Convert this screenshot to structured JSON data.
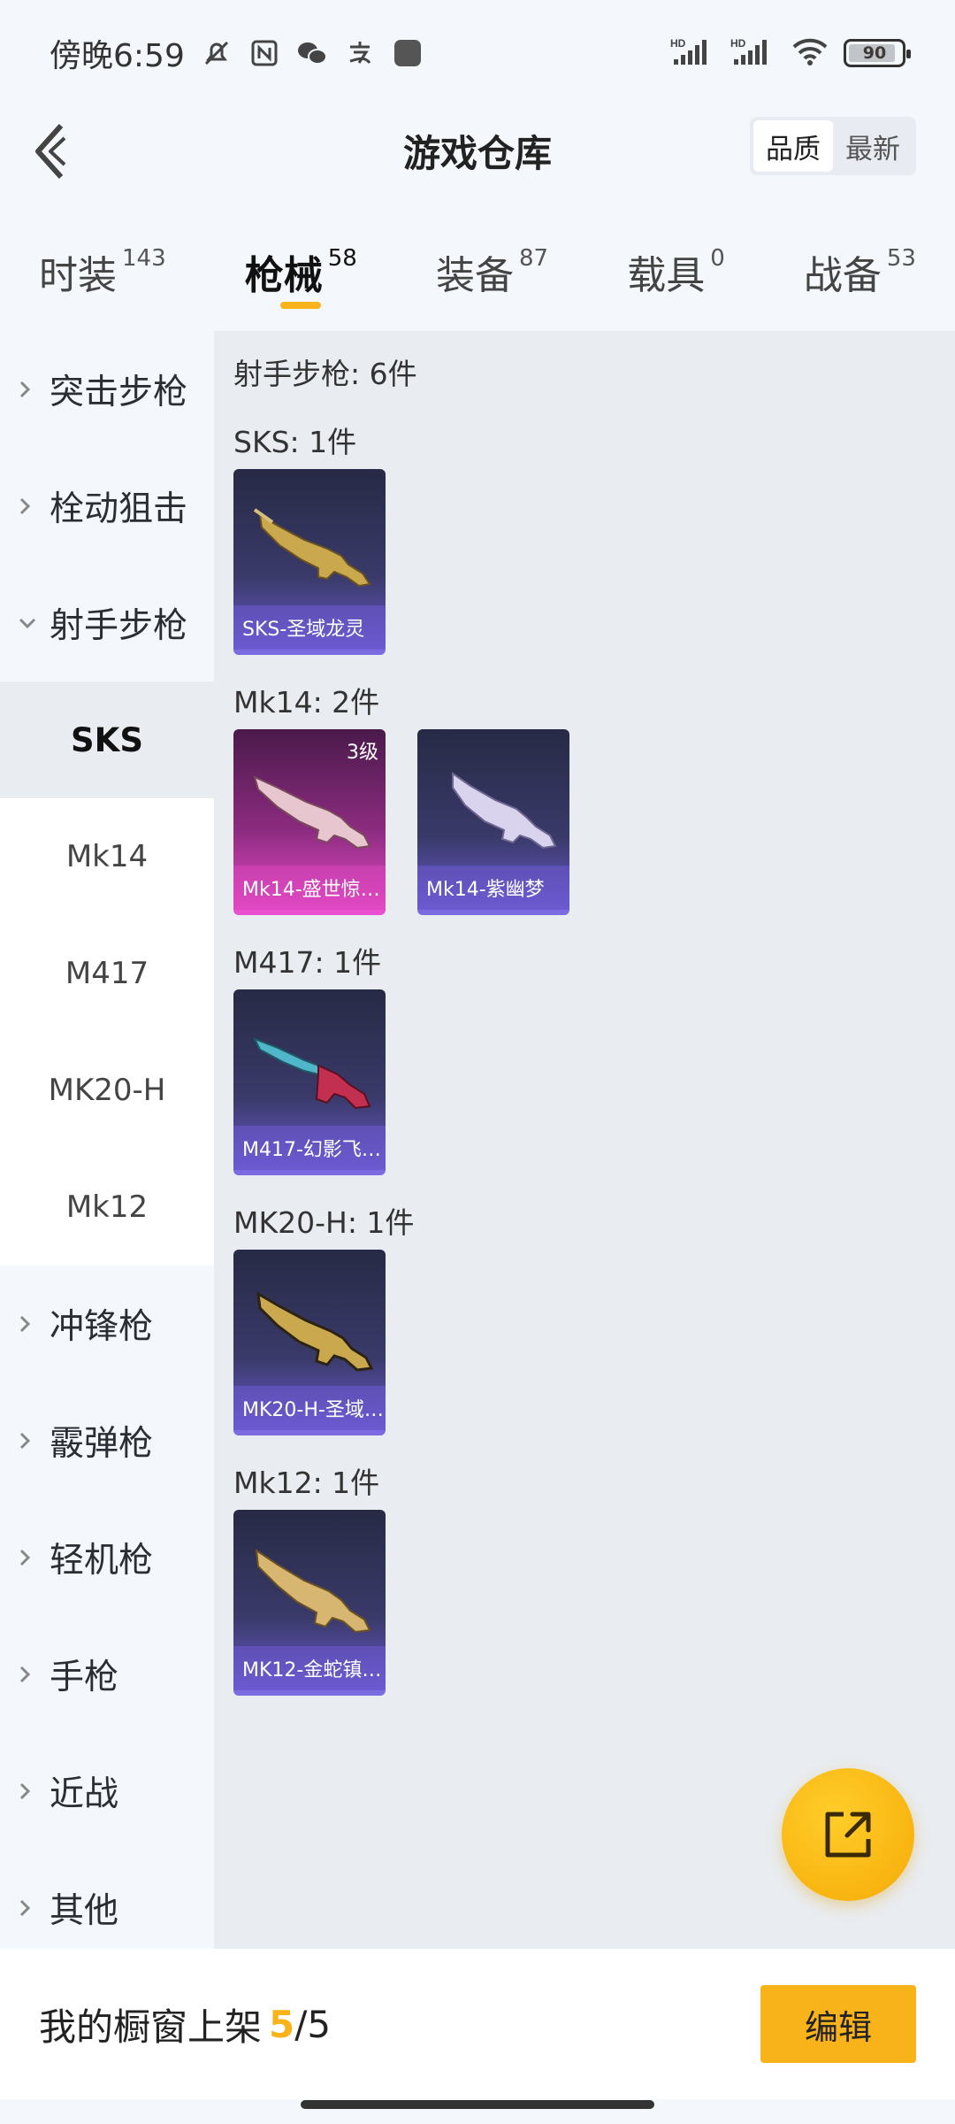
{
  "status_bar": {
    "time": "傍晚6:59",
    "battery_level": "90",
    "battery_fraction": 0.9,
    "left_icons": [
      "mute-bell-icon",
      "nfc-icon",
      "wechat-icon",
      "alipay-icon",
      "app-square-icon"
    ],
    "right_icons": [
      "hd-signal-icon",
      "hd-signal-icon",
      "wifi-icon",
      "battery-icon"
    ],
    "hd_label": "HD"
  },
  "header": {
    "title": "游戏仓库",
    "sort_options": [
      "品质",
      "最新"
    ],
    "sort_active": "品质"
  },
  "category_tabs": [
    {
      "label": "时装",
      "count": "143"
    },
    {
      "label": "枪械",
      "count": "58",
      "active": true
    },
    {
      "label": "装备",
      "count": "87"
    },
    {
      "label": "载具",
      "count": "0"
    },
    {
      "label": "战备",
      "count": "53"
    }
  ],
  "sidebar": {
    "before": [
      "突击步枪",
      "栓动狙击"
    ],
    "open_category": "射手步枪",
    "sub_items": [
      "SKS",
      "Mk14",
      "M417",
      "MK20-H",
      "Mk12"
    ],
    "active_sub": "SKS",
    "after": [
      "冲锋枪",
      "霰弹枪",
      "轻机枪",
      "手枪",
      "近战",
      "其他"
    ]
  },
  "content": {
    "section_title": "射手步枪: 6件",
    "groups": [
      {
        "title": "SKS: 1件",
        "items": [
          {
            "name": "SKS-圣域龙灵",
            "level": "",
            "tier": "purple"
          }
        ]
      },
      {
        "title": "Mk14: 2件",
        "items": [
          {
            "name": "Mk14-盛世惊…",
            "level": "3级",
            "tier": "pink"
          },
          {
            "name": "Mk14-紫幽梦",
            "level": "",
            "tier": "purple"
          }
        ]
      },
      {
        "title": "M417: 1件",
        "items": [
          {
            "name": "M417-幻影飞…",
            "level": "",
            "tier": "purple"
          }
        ]
      },
      {
        "title": "MK20-H: 1件",
        "items": [
          {
            "name": "MK20-H-圣域…",
            "level": "",
            "tier": "purple"
          }
        ]
      },
      {
        "title": "Mk12: 1件",
        "items": [
          {
            "name": "MK12-金蛇镇…",
            "level": "",
            "tier": "purple"
          }
        ]
      }
    ]
  },
  "bottom_bar": {
    "label": "我的橱窗上架",
    "current": "5",
    "separator": "/",
    "total": "5",
    "edit_label": "编辑"
  },
  "colors": {
    "accent": "#f7b319",
    "content_bg": "#e9ecf0",
    "sidebar_bg": "#f4f7fb",
    "card_purple": "#6a5bd1",
    "card_pink": "#e44bc6"
  }
}
